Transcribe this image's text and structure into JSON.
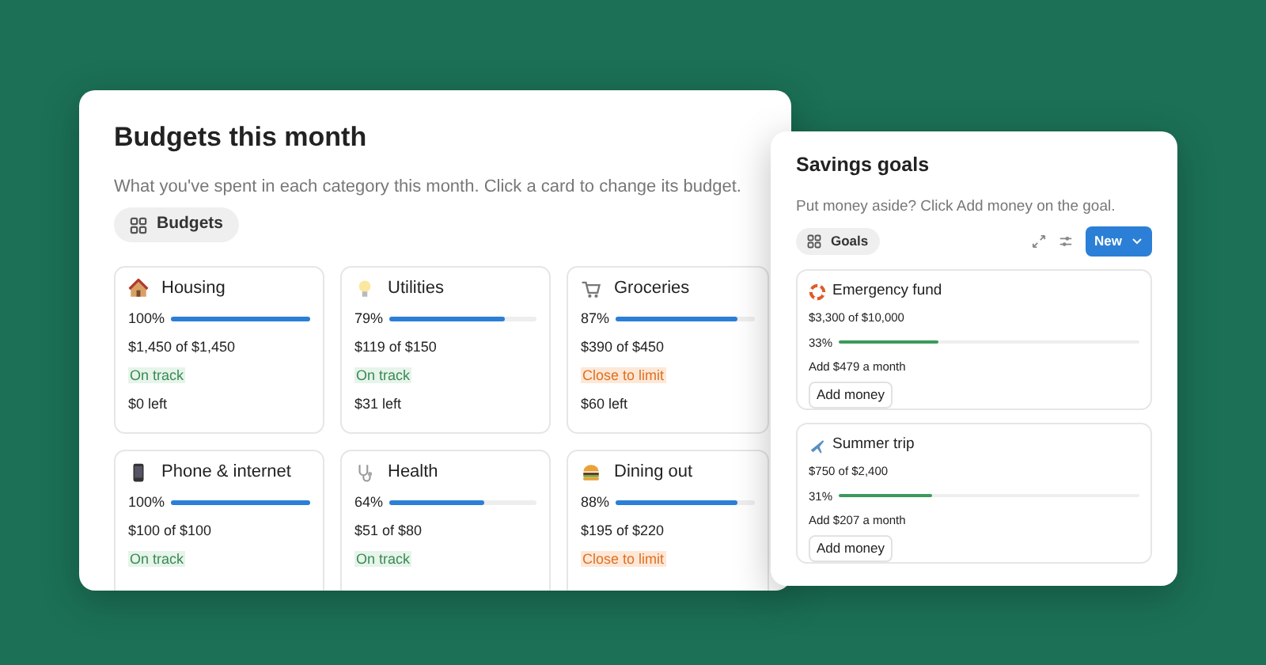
{
  "budgets_panel": {
    "title": "Budgets this month",
    "subtitle": "What you've spent in each category this month. Click a card to change its budget.",
    "view_chip": "Budgets",
    "cards": [
      {
        "name": "Housing",
        "percent": "100%",
        "level": 1.0,
        "amount": "$1,450 of $1,450",
        "status": "On track",
        "kind": "ok",
        "left": "$0 left"
      },
      {
        "name": "Utilities",
        "percent": "79%",
        "level": 0.79,
        "amount": "$119 of $150",
        "status": "On track",
        "kind": "ok",
        "left": "$31 left"
      },
      {
        "name": "Groceries",
        "percent": "87%",
        "level": 0.87,
        "amount": "$390 of $450",
        "status": "Close to limit",
        "kind": "warn",
        "left": "$60 left"
      },
      {
        "name": "Phone & internet",
        "percent": "100%",
        "level": 1.0,
        "amount": "$100 of $100",
        "status": "On track",
        "kind": "ok"
      },
      {
        "name": "Health",
        "percent": "64%",
        "level": 0.64,
        "amount": "$51 of $80",
        "status": "On track",
        "kind": "ok"
      },
      {
        "name": "Dining out",
        "percent": "88%",
        "level": 0.88,
        "amount": "$195 of $220",
        "status": "Close to limit",
        "kind": "warn"
      }
    ]
  },
  "goals_panel": {
    "title": "Savings goals",
    "subtitle": "Put money aside? Click Add money on the goal.",
    "view_chip": "Goals",
    "new_button": "New",
    "goals": [
      {
        "name": "Emergency fund",
        "amount": "$3,300 of $10,000",
        "percent": "33%",
        "level": 0.33,
        "plan": "Add $479 a month",
        "button": "Add money"
      },
      {
        "name": "Summer trip",
        "amount": "$750 of $2,400",
        "percent": "31%",
        "level": 0.31,
        "plan": "Add $207 a month",
        "button": "Add money"
      }
    ]
  }
}
